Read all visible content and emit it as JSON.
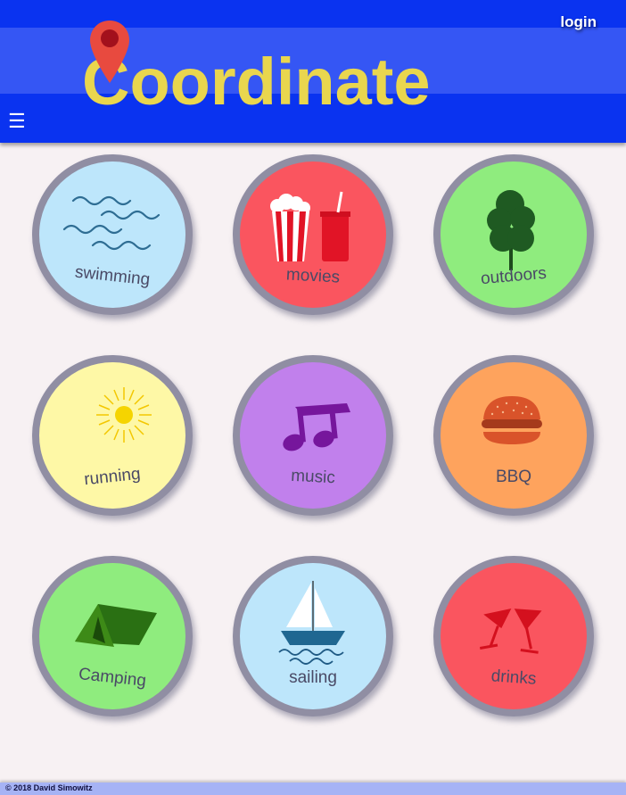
{
  "header": {
    "login_label": "login",
    "logo_text": "Coordinate",
    "menu_icon": "☰"
  },
  "activities": [
    {
      "label": "swimming",
      "icon": "waves-icon",
      "color": "#bde6fb"
    },
    {
      "label": "movies",
      "icon": "popcorn-soda-icon",
      "color": "#fa555f"
    },
    {
      "label": "outdoors",
      "icon": "tree-icon",
      "color": "#8fec7e"
    },
    {
      "label": "running",
      "icon": "sun-icon",
      "color": "#fef8a6"
    },
    {
      "label": "music",
      "icon": "music-note-icon",
      "color": "#c180ec"
    },
    {
      "label": "BBQ",
      "icon": "burger-icon",
      "color": "#fea35d"
    },
    {
      "label": "Camping",
      "icon": "tent-icon",
      "color": "#8fec7e"
    },
    {
      "label": "sailing",
      "icon": "sailboat-icon",
      "color": "#bde6fb"
    },
    {
      "label": "drinks",
      "icon": "cocktail-icon",
      "color": "#fa555f"
    }
  ],
  "footer": {
    "copyright": "© 2018 David Simowitz"
  }
}
